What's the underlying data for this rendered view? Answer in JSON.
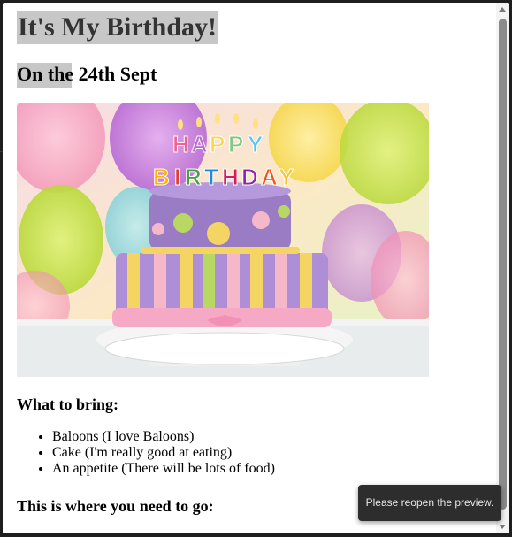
{
  "page": {
    "title": "It's My Birthday!",
    "subtitle": "On the 24th Sept",
    "image_alt": "",
    "bring_heading": "What to bring:",
    "bring_items": [
      "Baloons (I love Baloons)",
      "Cake (I'm really good at eating)",
      "An appetite (There will be lots of food)"
    ],
    "go_heading": "This is where you need to go:"
  },
  "cake_image": {
    "candle_letters": [
      "H",
      "A",
      "P",
      "P",
      "Y",
      "B",
      "I",
      "R",
      "T",
      "H",
      "D",
      "A",
      "Y"
    ]
  },
  "toast": {
    "message": "Please reopen the preview."
  },
  "colors": {
    "heading_highlight": "#c7c7c7",
    "toast_bg": "#2d2d2d",
    "frame_bg": "#1e1e1e"
  }
}
